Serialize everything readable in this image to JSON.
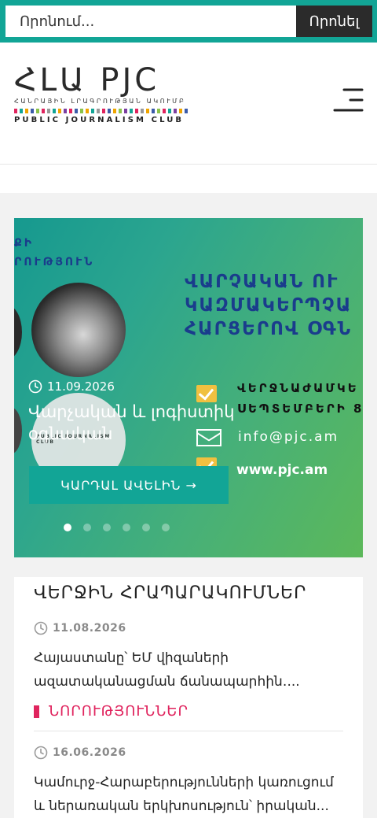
{
  "search": {
    "placeholder": "Որոնում...",
    "button_label": "Որոնել"
  },
  "header": {
    "logo_main": "ՀԼԱ PJC",
    "logo_subtitle": "ՀԱՆՐԱՅԻՆ ԼՐԱԳՐՈՒԹՅԱՆ ԱԿՈՒՄԲ",
    "logo_club": "PUBLIC JOURNALISM CLUB"
  },
  "slider": {
    "image_text": {
      "top_lines": [
        "ՔԻ",
        "ՐՈՒԹՅՈՒՆ"
      ],
      "blue_lines": [
        "ՎԱՐՉԱԿԱՆ ՈՒ",
        "ԿԱԶՄԱԿԵՐՊՉԱ",
        "ՀԱՐՑԵՐՈՎ ՕԳՆ"
      ],
      "dark_lines": [
        "ՎԵՐՋՆԱԺԱՄԿԵ",
        "ՍԵՊՏԵՄԲԵՐԻ 8"
      ],
      "email": "info@pjc.am",
      "website": "www.pjc.am"
    },
    "date": "11.09.2026",
    "title": "Վարչական և լոգիստիկ օգնական",
    "read_more": "ԿԱՐԴԱԼ ԱՎԵԼԻՆ →",
    "dots_count": 6,
    "active_dot": 1
  },
  "latest": {
    "title": "ՎԵՐՋԻՆ ՀՐԱՊԱՐԱԿՈՒՄՆԵՐ",
    "posts": [
      {
        "date": "11.08.2026",
        "text": "Հայաստանը՝ ԵՄ վիզաների ազատականացման ճանապարհին․...",
        "category": "ՆՈՐՈՒԹՅՈՒՆՆԵՐ"
      },
      {
        "date": "16.06.2026",
        "text": "Կամուրջ-Հարաբերությունների կառուցում և ներառական երկխոսություն՝ իրական..."
      }
    ]
  },
  "colors": {
    "accent": "#12a596",
    "category": "#e0245e",
    "dark": "#2b2b2b"
  }
}
